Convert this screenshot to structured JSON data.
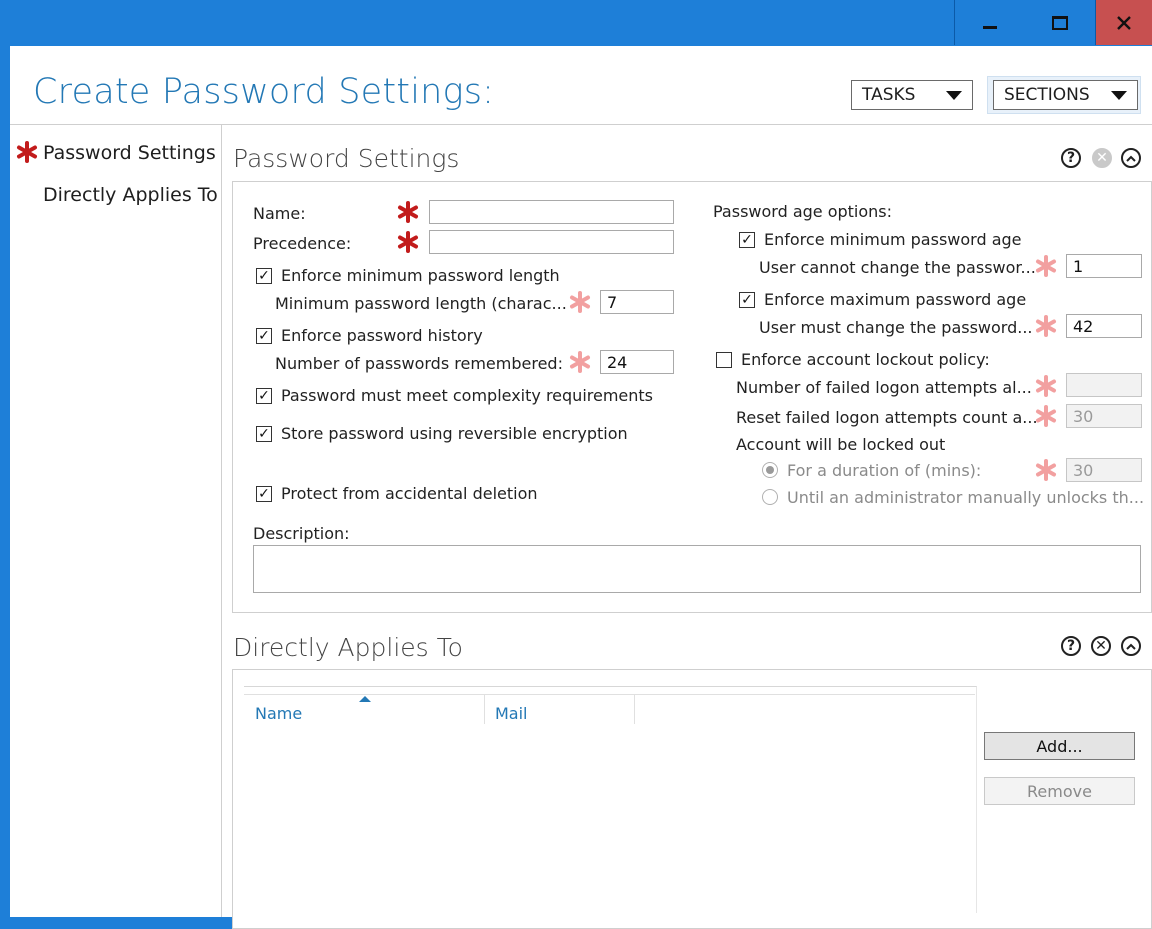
{
  "window": {
    "min_symbol": "—",
    "max_symbol": "▢",
    "close_symbol": "✕"
  },
  "page_title": "Create Password Settings:",
  "toolbar": {
    "tasks_label": "TASKS",
    "sections_label": "SECTIONS"
  },
  "nav": {
    "items": [
      {
        "label": "Password Settings",
        "required": true
      },
      {
        "label": "Directly Applies To",
        "required": false
      }
    ]
  },
  "password_settings": {
    "title": "Password Settings",
    "name_label": "Name:",
    "name_value": "",
    "precedence_label": "Precedence:",
    "precedence_value": "",
    "enforce_min_length_label": "Enforce minimum password length",
    "min_length_label": "Minimum password length (charac...",
    "min_length_value": "7",
    "enforce_history_label": "Enforce password history",
    "history_label": "Number of passwords remembered:",
    "history_value": "24",
    "complexity_label": "Password must meet complexity requirements",
    "reversible_label": "Store password using reversible encryption",
    "protect_label": "Protect from accidental deletion",
    "description_label": "Description:",
    "description_value": "",
    "age_options_label": "Password age options:",
    "enforce_min_age_label": "Enforce minimum password age",
    "min_age_label": "User cannot change the passwor...",
    "min_age_value": "1",
    "enforce_max_age_label": "Enforce maximum password age",
    "max_age_label": "User must change the password...",
    "max_age_value": "42",
    "lockout_label": "Enforce account lockout policy:",
    "failed_attempts_label": "Number of failed logon attempts al...",
    "failed_attempts_value": "",
    "reset_label": "Reset failed logon attempts count a...",
    "reset_value": "30",
    "locked_out_label": "Account will be locked out",
    "duration_label": "For a duration of (mins):",
    "duration_value": "30",
    "until_admin_label": "Until an administrator manually unlocks th...",
    "checks": {
      "enforce_min_length": true,
      "enforce_history": true,
      "complexity": true,
      "reversible": true,
      "protect": true,
      "enforce_min_age": true,
      "enforce_max_age": true,
      "lockout": false
    },
    "check_mark": "✓"
  },
  "directly_applies_to": {
    "title": "Directly Applies To",
    "columns": [
      "Name",
      "Mail"
    ],
    "add_label": "Add...",
    "remove_label": "Remove"
  },
  "icons": {
    "help": "?",
    "close": "✕",
    "collapse": "︿"
  }
}
